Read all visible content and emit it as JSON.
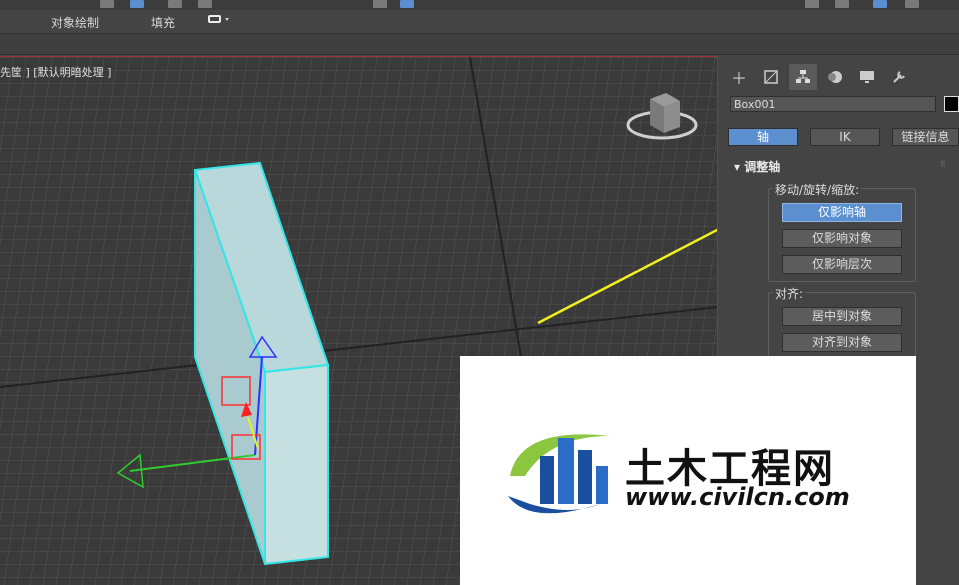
{
  "ribbon": {
    "tab_object_paint": "对象绘制",
    "tab_fill": "填充"
  },
  "viewport": {
    "label": "先筐 ] [默认明暗处理 ]"
  },
  "command_panel": {
    "object_name": "Box001",
    "subtabs": {
      "pivot": "轴",
      "ik": "IK",
      "link_info": "链接信息"
    },
    "rollout_title": "调整轴",
    "move_group_label": "移动/旋转/缩放:",
    "btn_affect_pivot": "仅影响轴",
    "btn_affect_object": "仅影响对象",
    "btn_affect_hierarchy": "仅影响层次",
    "align_group_label": "对齐:",
    "btn_center_to_object": "居中到对象",
    "btn_align_to_object": "对齐到对象"
  },
  "watermark": {
    "text_cn": "土木工程网",
    "text_url": "www.civilcn.com"
  },
  "colors": {
    "accent": "#5b8fd0",
    "annotation_arrow": "#f0f020",
    "selection": "#33e5e5"
  }
}
